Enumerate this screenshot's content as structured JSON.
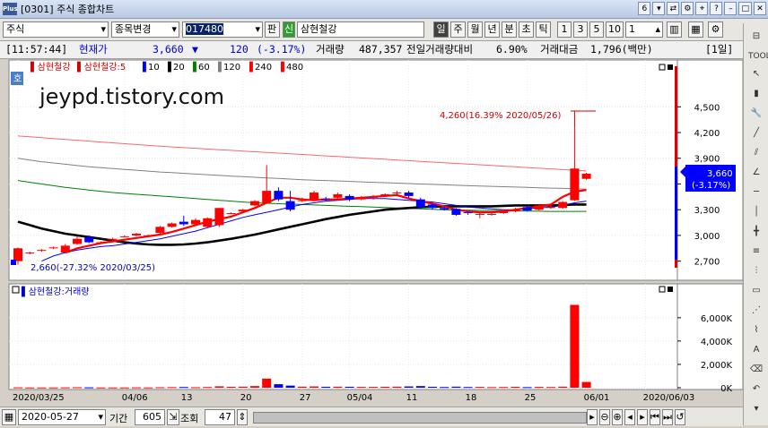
{
  "window": {
    "title": "[0301] 주식 종합차트",
    "logo": "Plus",
    "page_num": "6"
  },
  "toolbar": {
    "market": "주식",
    "change_item": "종목변경",
    "code": "017480",
    "pan": "판",
    "shin": "신",
    "stock_name": "삼현철강",
    "periods": [
      "일",
      "주",
      "월",
      "년",
      "분",
      "초",
      "틱"
    ],
    "active_period": "일",
    "numbers": [
      "1",
      "3",
      "5",
      "10"
    ],
    "unit": "1"
  },
  "info": {
    "time": "[11:57:44]",
    "price_label": "현재가",
    "price": "3,660",
    "arrow": "▼",
    "change": "120",
    "change_pct": "(-3.17%)",
    "volume_label": "거래량",
    "volume": "487,357",
    "prev_ratio_label": "전일거래량대비",
    "prev_ratio": "6.90%",
    "amount_label": "거래대금",
    "amount": "1,796(백만)",
    "period_tag": "[1일]"
  },
  "legend": {
    "name": "삼현철강",
    "ma_name": "삼현철강:5",
    "mas": [
      {
        "label": "10",
        "color": "#0000ff"
      },
      {
        "label": "20",
        "color": "#000000"
      },
      {
        "label": "60",
        "color": "#008000"
      },
      {
        "label": "120",
        "color": "#808080"
      },
      {
        "label": "240",
        "color": "#ff0000"
      },
      {
        "label": "480",
        "color": "#ff0000"
      }
    ],
    "ho": "호"
  },
  "watermark": "jeypd.tistory.com",
  "annotations": {
    "high": "4,260(16.39% 2020/05/26)",
    "low": "2,660(-27.32% 2020/03/25)"
  },
  "price_labels": {
    "current": "3,660",
    "current_pct": "(-3.17%)"
  },
  "volume_legend": "삼현철강:거래량",
  "colors": {
    "up": "#ff0000",
    "down": "#0000ff"
  },
  "chart_data": [
    {
      "type": "candlestick",
      "ylim": [
        2550,
        4900
      ],
      "yticks": [
        "4,500",
        "4,200",
        "3,900",
        "3,600",
        "3,300",
        "3,000",
        "2,700"
      ],
      "ytick_values": [
        4500,
        4200,
        3900,
        3600,
        3300,
        3000,
        2700
      ],
      "candles": [
        [
          2700,
          2850,
          2660,
          2860
        ],
        [
          2800,
          2800,
          2780,
          2810
        ],
        [
          2830,
          2830,
          2810,
          2840
        ],
        [
          2860,
          2860,
          2840,
          2870
        ],
        [
          2800,
          2880,
          2790,
          2900
        ],
        [
          2900,
          2960,
          2890,
          2990
        ],
        [
          2980,
          2920,
          2910,
          3000
        ],
        [
          2920,
          2920,
          2910,
          2930
        ],
        [
          2960,
          2960,
          2940,
          2970
        ],
        [
          2990,
          2990,
          2980,
          3000
        ],
        [
          3000,
          3020,
          2990,
          3030
        ],
        [
          3000,
          3000,
          2990,
          3010
        ],
        [
          3030,
          3100,
          3020,
          3110
        ],
        [
          3100,
          3140,
          3090,
          3150
        ],
        [
          3160,
          3130,
          3110,
          3230
        ],
        [
          3130,
          3180,
          3120,
          3200
        ],
        [
          3100,
          3200,
          3090,
          3210
        ],
        [
          3120,
          3320,
          3100,
          3320
        ],
        [
          3260,
          3260,
          3250,
          3270
        ],
        [
          3280,
          3300,
          3270,
          3310
        ],
        [
          3350,
          3400,
          3340,
          3410
        ],
        [
          3380,
          3520,
          3370,
          3820
        ],
        [
          3520,
          3420,
          3400,
          3560
        ],
        [
          3400,
          3300,
          3280,
          3520
        ],
        [
          3400,
          3410,
          3390,
          3440
        ],
        [
          3420,
          3500,
          3400,
          3520
        ],
        [
          3430,
          3420,
          3400,
          3450
        ],
        [
          3440,
          3480,
          3420,
          3500
        ],
        [
          3460,
          3420,
          3400,
          3480
        ],
        [
          3420,
          3440,
          3410,
          3460
        ],
        [
          3440,
          3450,
          3420,
          3470
        ],
        [
          3470,
          3480,
          3450,
          3490
        ],
        [
          3490,
          3500,
          3470,
          3520
        ],
        [
          3500,
          3460,
          3440,
          3520
        ],
        [
          3420,
          3330,
          3310,
          3440
        ],
        [
          3360,
          3320,
          3300,
          3380
        ],
        [
          3320,
          3300,
          3290,
          3340
        ],
        [
          3310,
          3240,
          3230,
          3320
        ],
        [
          3270,
          3260,
          3240,
          3280
        ],
        [
          3250,
          3250,
          3200,
          3260
        ],
        [
          3250,
          3250,
          3230,
          3270
        ],
        [
          3260,
          3290,
          3250,
          3300
        ],
        [
          3280,
          3300,
          3270,
          3320
        ],
        [
          3330,
          3290,
          3280,
          3340
        ],
        [
          3300,
          3350,
          3290,
          3360
        ],
        [
          3320,
          3330,
          3310,
          3350
        ],
        [
          3320,
          3390,
          3310,
          3400
        ],
        [
          3410,
          3780,
          3400,
          4260
        ],
        [
          3660,
          3720,
          3650,
          3730
        ]
      ],
      "ma_series": [
        {
          "name": "5",
          "color": "#ff0000",
          "start": 4,
          "values": [
            2800,
            2850,
            2880,
            2910,
            2930,
            2950,
            2970,
            2990,
            3010,
            3040,
            3080,
            3120,
            3160,
            3190,
            3220,
            3270,
            3320,
            3380,
            3440,
            3440,
            3420,
            3410,
            3420,
            3420,
            3430,
            3440,
            3450,
            3460,
            3470,
            3430,
            3400,
            3370,
            3340,
            3300,
            3280,
            3270,
            3270,
            3280,
            3300,
            3320,
            3340,
            3360,
            3450,
            3510,
            3530
          ]
        },
        {
          "name": "10",
          "color": "#0000ff",
          "start": 2,
          "values": [
            2700,
            2760,
            2800,
            2830,
            2850,
            2870,
            2880,
            2900,
            2920,
            2940,
            2960,
            2990,
            3020,
            3050,
            3090,
            3130,
            3170,
            3210,
            3240,
            3270,
            3300,
            3330,
            3360,
            3380,
            3400,
            3410,
            3420,
            3430,
            3430,
            3430,
            3420,
            3410,
            3400,
            3390,
            3370,
            3350,
            3330,
            3320,
            3310,
            3300,
            3300,
            3310,
            3320,
            3330,
            3350,
            3380,
            3400
          ]
        },
        {
          "name": "20",
          "color": "#000000",
          "start": 0,
          "values": [
            3160,
            3120,
            3080,
            3050,
            3020,
            3000,
            2980,
            2960,
            2940,
            2920,
            2905,
            2895,
            2890,
            2890,
            2895,
            2905,
            2920,
            2940,
            2960,
            2985,
            3010,
            3040,
            3070,
            3100,
            3130,
            3160,
            3190,
            3215,
            3240,
            3260,
            3280,
            3300,
            3310,
            3320,
            3330,
            3335,
            3340,
            3340,
            3340,
            3340,
            3340,
            3345,
            3350,
            3350,
            3350,
            3350,
            3355,
            3360,
            3360
          ]
        },
        {
          "name": "60",
          "color": "#008000",
          "start": 0,
          "values": [
            3640,
            3620,
            3600,
            3580,
            3560,
            3545,
            3530,
            3515,
            3500,
            3490,
            3480,
            3470,
            3460,
            3450,
            3440,
            3430,
            3420,
            3410,
            3400,
            3390,
            3380,
            3375,
            3370,
            3365,
            3360,
            3355,
            3350,
            3345,
            3340,
            3335,
            3330,
            3325,
            3320,
            3315,
            3310,
            3305,
            3300,
            3297,
            3294,
            3292,
            3290,
            3288,
            3286,
            3284,
            3282,
            3280,
            3280,
            3280,
            3280
          ]
        },
        {
          "name": "120",
          "color": "#808080",
          "start": 0,
          "values": [
            3900,
            3880,
            3860,
            3845,
            3830,
            3815,
            3800,
            3790,
            3780,
            3770,
            3760,
            3750,
            3740,
            3732,
            3724,
            3716,
            3708,
            3700,
            3692,
            3685,
            3678,
            3671,
            3664,
            3657,
            3650,
            3645,
            3640,
            3635,
            3630,
            3625,
            3620,
            3615,
            3610,
            3605,
            3600,
            3595,
            3590,
            3585,
            3580,
            3576,
            3572,
            3568,
            3564,
            3560,
            3556,
            3552,
            3548,
            3544,
            3540
          ]
        },
        {
          "name": "240",
          "color": "#ff0000",
          "start": 0,
          "values": [
            4160,
            4150,
            4140,
            4130,
            4120,
            4110,
            4100,
            4090,
            4080,
            4070,
            4060,
            4050,
            4040,
            4032,
            4024,
            4016,
            4008,
            4000,
            3992,
            3984,
            3976,
            3968,
            3960,
            3952,
            3944,
            3936,
            3928,
            3920,
            3912,
            3904,
            3896,
            3888,
            3880,
            3872,
            3864,
            3856,
            3848,
            3840,
            3832,
            3824,
            3816,
            3808,
            3800,
            3792,
            3784,
            3776,
            3768,
            3760,
            3752
          ]
        },
        {
          "name": "480",
          "color": "#ff0000",
          "start": 0,
          "values": [
            4740,
            4735,
            4730,
            4725,
            4720,
            4715,
            4710,
            4705,
            4700,
            4695,
            4690,
            4685,
            4680,
            4675,
            4670,
            4665,
            4660,
            4655,
            4650,
            4645,
            4640,
            4635,
            4630,
            4625,
            4620,
            4615,
            4610,
            4605,
            4600,
            4595,
            4590,
            4585,
            4580,
            4575,
            4570,
            4565,
            4560,
            4555,
            4550,
            4545,
            4540,
            4535,
            4530,
            4525,
            4520,
            4515,
            4510,
            4505,
            4500
          ]
        }
      ]
    },
    {
      "type": "bar",
      "title": "삼현철강:거래량",
      "ylim": [
        0,
        7600000
      ],
      "yticks": [
        "6,000K",
        "4,000K",
        "2,000K",
        "0K"
      ],
      "ytick_values": [
        6000000,
        4000000,
        2000000,
        0
      ],
      "volumes": [
        30000,
        20000,
        20000,
        20000,
        30000,
        40000,
        30000,
        20000,
        20000,
        20000,
        30000,
        20000,
        40000,
        50000,
        60000,
        40000,
        60000,
        120000,
        80000,
        90000,
        140000,
        780000,
        300000,
        180000,
        90000,
        110000,
        80000,
        90000,
        80000,
        70000,
        70000,
        80000,
        90000,
        110000,
        140000,
        80000,
        60000,
        90000,
        60000,
        70000,
        50000,
        60000,
        80000,
        50000,
        70000,
        60000,
        90000,
        7100000,
        490000
      ]
    }
  ],
  "xlabels": [
    {
      "i": 0,
      "t": "2020/03/25"
    },
    {
      "i": 9,
      "t": "04/06"
    },
    {
      "i": 14,
      "t": "13"
    },
    {
      "i": 19,
      "t": "20"
    },
    {
      "i": 24,
      "t": "27"
    },
    {
      "i": 28,
      "t": "05/04"
    },
    {
      "i": 33,
      "t": "11"
    },
    {
      "i": 38,
      "t": "18"
    },
    {
      "i": 43,
      "t": "25"
    },
    {
      "i": 48,
      "t": "06/01"
    },
    {
      "i": 53,
      "t": "2020/06/03"
    }
  ],
  "bottom": {
    "date": "2020-05-27",
    "period_label": "기간",
    "period": "605",
    "query_label": "조회",
    "count": "47"
  }
}
